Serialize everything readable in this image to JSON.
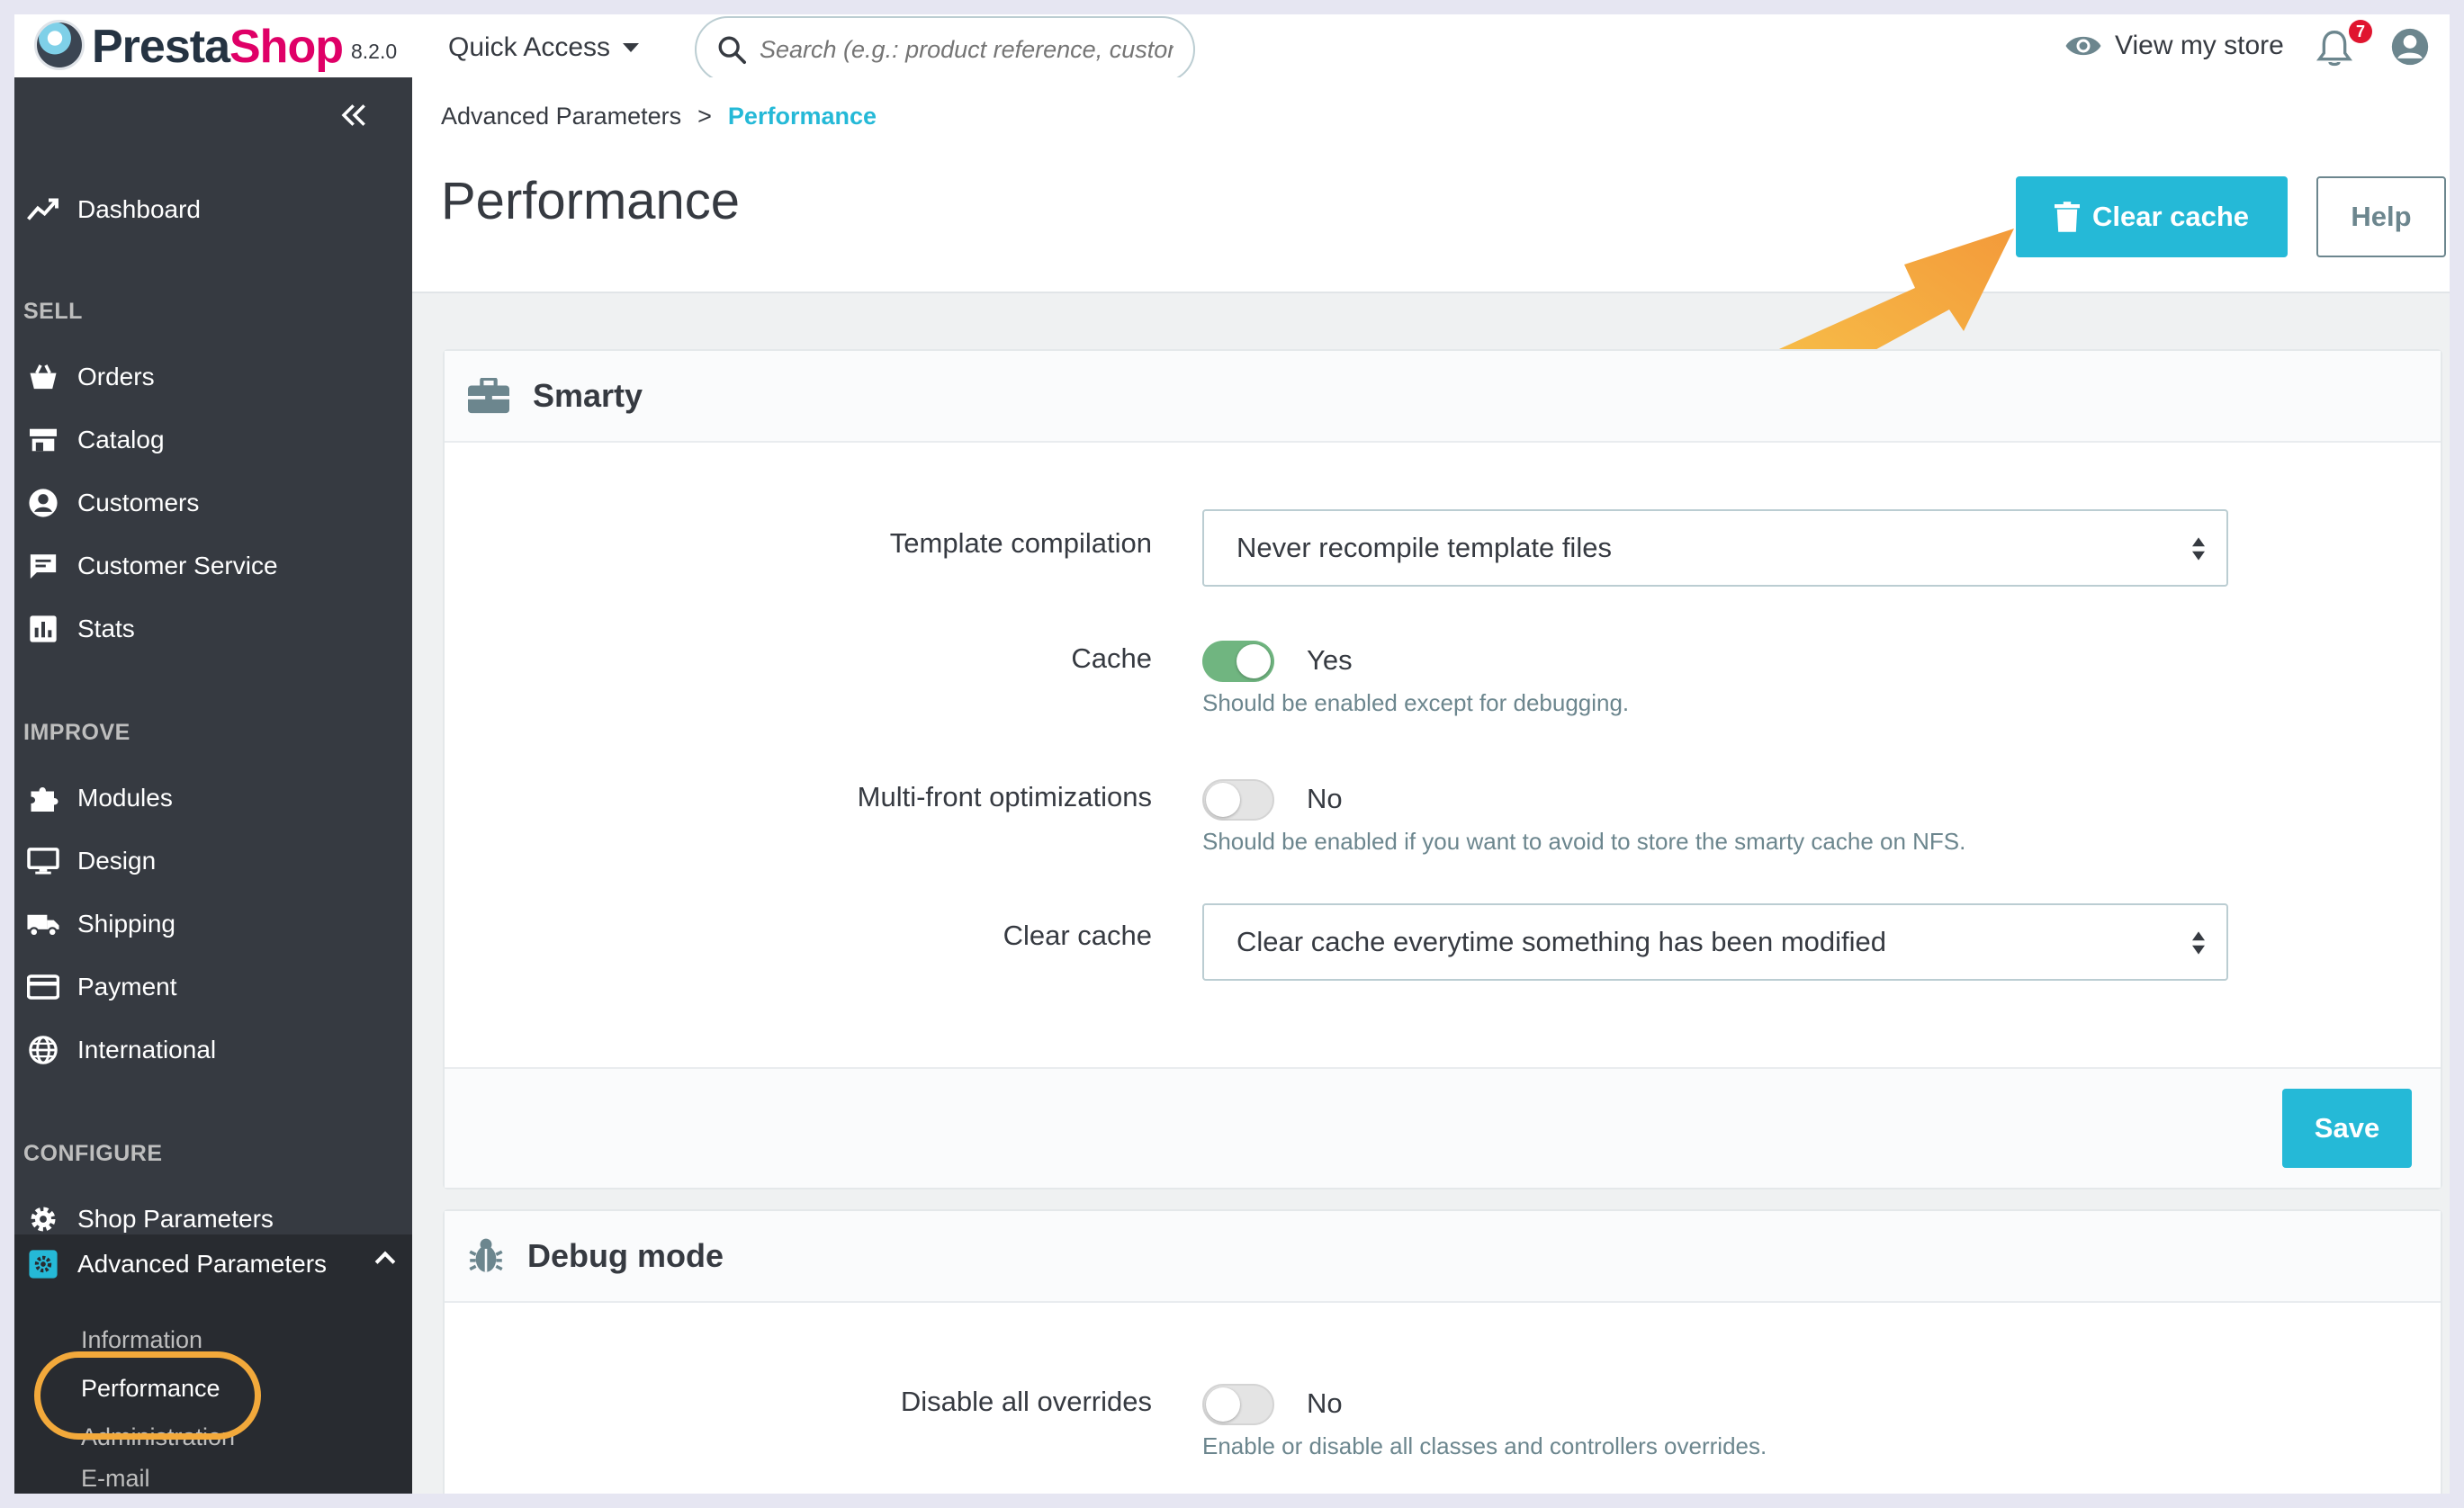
{
  "header": {
    "brand_main": "Presta",
    "brand_accent": "Shop",
    "version": "8.2.0",
    "quick_access": "Quick Access",
    "search_placeholder": "Search (e.g.: product reference, custon",
    "view_store": "View my store",
    "notifications_count": "7",
    "icons": [
      "logo-icon",
      "search-icon",
      "eye-icon",
      "bell-icon",
      "account-icon",
      "chevron-down-icon"
    ]
  },
  "sidebar": {
    "dashboard": "Dashboard",
    "sections": {
      "sell": "SELL",
      "improve": "IMPROVE",
      "configure": "CONFIGURE"
    },
    "sell_items": [
      "Orders",
      "Catalog",
      "Customers",
      "Customer Service",
      "Stats"
    ],
    "improve_items": [
      "Modules",
      "Design",
      "Shipping",
      "Payment",
      "International"
    ],
    "configure_items": [
      "Shop Parameters",
      "Advanced Parameters"
    ],
    "advanced_sub": [
      "Information",
      "Performance",
      "Administration",
      "E-mail"
    ]
  },
  "breadcrumb": {
    "parent": "Advanced Parameters",
    "separator": ">",
    "current": "Performance"
  },
  "page": {
    "title": "Performance",
    "clear_cache_button": "Clear cache",
    "help_button": "Help"
  },
  "smarty": {
    "title": "Smarty",
    "template_compilation_label": "Template compilation",
    "template_compilation_value": "Never recompile template files",
    "cache_label": "Cache",
    "cache_value": "Yes",
    "cache_enabled": true,
    "cache_help": "Should be enabled except for debugging.",
    "multifront_label": "Multi-front optimizations",
    "multifront_value": "No",
    "multifront_enabled": false,
    "multifront_help": "Should be enabled if you want to avoid to store the smarty cache on NFS.",
    "clear_cache_label": "Clear cache",
    "clear_cache_value": "Clear cache everytime something has been modified",
    "save_button": "Save"
  },
  "debug": {
    "title": "Debug mode",
    "disable_overrides_label": "Disable all overrides",
    "disable_overrides_value": "No",
    "disable_overrides_enabled": false,
    "disable_overrides_help": "Enable or disable all classes and controllers overrides."
  },
  "colors": {
    "primary": "#25b9d7",
    "sidebar": "#363a41",
    "toggle_on": "#70b580",
    "brand_accent": "#df0067",
    "highlight": "#f2a93b"
  }
}
